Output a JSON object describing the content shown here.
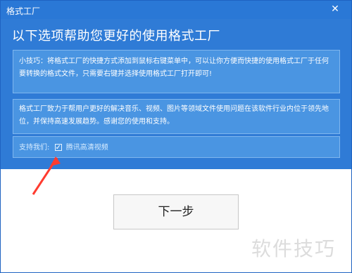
{
  "window": {
    "title": "格式工厂",
    "heading": "以下选项帮助您更好的使用格式工厂"
  },
  "tip": {
    "text": "小技巧：将格式工厂的快捷方式添加到鼠标右键菜单中，可以让你方便而快捷的使用格式工厂于任何要转换的格式文件，只需要右键并选择使用格式工厂打开即可!"
  },
  "intro": {
    "text": "格式工厂致力于帮用户更好的解决音乐、视频、图片等领域文件使用问题在该软件行业内位于领先地位，并保持高速发展趋势。感谢您的使用和支持。"
  },
  "support": {
    "label": "支持我们:",
    "checkbox_label": "腾讯高清视频",
    "checked": true
  },
  "buttons": {
    "next_label": "下一步",
    "close_icon": "close-icon"
  },
  "watermark": {
    "text": "软件技巧"
  },
  "colors": {
    "title_bar": "#2a78d6",
    "panel": "#2f7bd6",
    "box": "#4a95e2",
    "arrow": "#ff3b2f"
  }
}
